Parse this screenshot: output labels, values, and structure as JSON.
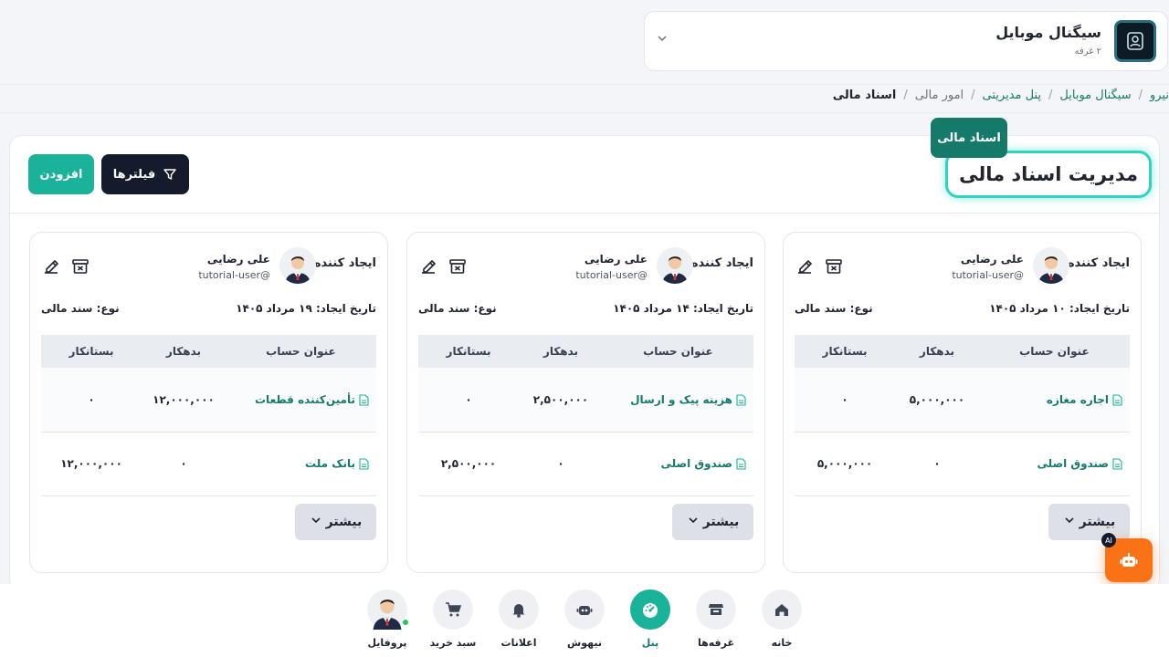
{
  "store": {
    "title": "سیگنال موبایل",
    "subtitle": "۲ غرفه"
  },
  "breadcrumb": [
    "نیرو",
    "سیگنال موبایل",
    "پنل مدیریتی",
    "امور مالی",
    "اسناد مالی"
  ],
  "page": {
    "title": "مدیریت اسناد مالی",
    "tooltip": "اسناد مالی"
  },
  "toolbar": {
    "filters_label": "فیلترها",
    "add_label": "افزودن"
  },
  "table_headers": {
    "account": "عنوان حساب",
    "debit": "بدهکار",
    "credit": "بستانکار"
  },
  "cards": [
    {
      "creator_label": "ایجاد کننده:",
      "user_name": "علی رضایی",
      "user_handle": "tutorial-user@",
      "date": "تاریخ ایجاد: ۱۰ مرداد ۱۴۰۵",
      "type": "نوع: سند مالی",
      "rows": [
        {
          "account": "اجاره مغازه",
          "debit": "۵,۰۰۰,۰۰۰",
          "credit": "۰"
        },
        {
          "account": "صندوق اصلی",
          "debit": "۰",
          "credit": "۵,۰۰۰,۰۰۰"
        }
      ],
      "more_label": "بیشتر"
    },
    {
      "creator_label": "ایجاد کننده:",
      "user_name": "علی رضایی",
      "user_handle": "tutorial-user@",
      "date": "تاریخ ایجاد: ۱۴ مرداد ۱۴۰۵",
      "type": "نوع: سند مالی",
      "rows": [
        {
          "account": "هزینه پیک و ارسال",
          "debit": "۲,۵۰۰,۰۰۰",
          "credit": "۰"
        },
        {
          "account": "صندوق اصلی",
          "debit": "۰",
          "credit": "۲,۵۰۰,۰۰۰"
        }
      ],
      "more_label": "بیشتر"
    },
    {
      "creator_label": "ایجاد کننده:",
      "user_name": "علی رضایی",
      "user_handle": "tutorial-user@",
      "date": "تاریخ ایجاد: ۱۹ مرداد ۱۴۰۵",
      "type": "نوع: سند مالی",
      "rows": [
        {
          "account": "تأمین‌کننده قطعات",
          "debit": "۱۲,۰۰۰,۰۰۰",
          "credit": "۰"
        },
        {
          "account": "بانک ملت",
          "debit": "۰",
          "credit": "۱۲,۰۰۰,۰۰۰"
        }
      ],
      "more_label": "بیشتر"
    }
  ],
  "nav": [
    {
      "label": "خانه",
      "icon": "home-icon"
    },
    {
      "label": "غرفه‌ها",
      "icon": "store-icon"
    },
    {
      "label": "پنل",
      "icon": "dashboard-icon",
      "active": true
    },
    {
      "label": "نیهوش",
      "icon": "robot-icon"
    },
    {
      "label": "اعلانات",
      "icon": "bell-icon"
    },
    {
      "label": "سبد خرید",
      "icon": "cart-icon"
    },
    {
      "label": "پروفایل",
      "icon": "avatar-icon"
    }
  ],
  "ai_badge": "AI",
  "colors": {
    "accent": "#1ab39a",
    "dark": "#141b2d",
    "link": "#167a6b",
    "fab": "#f97316"
  }
}
